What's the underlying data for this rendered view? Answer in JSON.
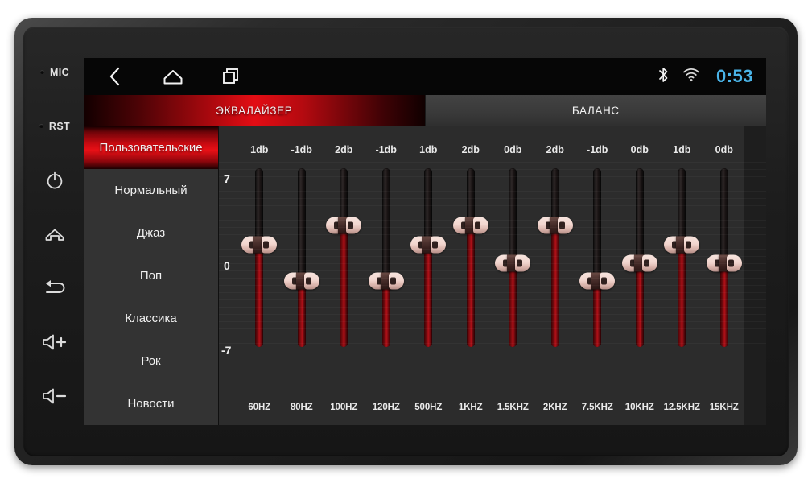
{
  "device": {
    "side_buttons": [
      {
        "name": "mic",
        "label": "MIC",
        "type": "label-hole"
      },
      {
        "name": "rst",
        "label": "RST",
        "type": "label-hole"
      },
      {
        "name": "power",
        "label": "power-icon",
        "type": "icon"
      },
      {
        "name": "home",
        "label": "home-icon",
        "type": "icon"
      },
      {
        "name": "back",
        "label": "back-icon",
        "type": "icon"
      },
      {
        "name": "volume-up",
        "label": "volume-up-icon",
        "type": "icon"
      },
      {
        "name": "volume-down",
        "label": "volume-down-icon",
        "type": "icon"
      }
    ]
  },
  "statusbar": {
    "nav": [
      {
        "name": "back-icon",
        "label": "back"
      },
      {
        "name": "home-icon",
        "label": "home"
      },
      {
        "name": "recents-icon",
        "label": "recents"
      }
    ],
    "bluetooth_icon": "bluetooth-icon",
    "wifi_icon": "wifi-icon",
    "clock": "0:53",
    "clock_color": "#4ab4e8"
  },
  "tabs": [
    {
      "label": "ЭКВАЛАЙЗЕР",
      "active": true
    },
    {
      "label": "БАЛАНС",
      "active": false
    }
  ],
  "presets": [
    {
      "label": "Пользовательские",
      "selected": true
    },
    {
      "label": "Нормальный",
      "selected": false
    },
    {
      "label": "Джаз",
      "selected": false
    },
    {
      "label": "Поп",
      "selected": false
    },
    {
      "label": "Классика",
      "selected": false
    },
    {
      "label": "Рок",
      "selected": false
    },
    {
      "label": "Новости",
      "selected": false
    }
  ],
  "equalizer": {
    "scale_top": "7",
    "scale_mid": "0",
    "scale_bottom": "-7",
    "range_min": -7,
    "range_max": 7,
    "bands": [
      {
        "freq": "60HZ",
        "db_label": "1db",
        "value": 1,
        "thumb_pct": 43
      },
      {
        "freq": "80HZ",
        "db_label": "-1db",
        "value": -1,
        "thumb_pct": 63
      },
      {
        "freq": "100HZ",
        "db_label": "2db",
        "value": 2,
        "thumb_pct": 32
      },
      {
        "freq": "120HZ",
        "db_label": "-1db",
        "value": -1,
        "thumb_pct": 63
      },
      {
        "freq": "500HZ",
        "db_label": "1db",
        "value": 1,
        "thumb_pct": 43
      },
      {
        "freq": "1KHZ",
        "db_label": "2db",
        "value": 2,
        "thumb_pct": 32
      },
      {
        "freq": "1.5KHZ",
        "db_label": "0db",
        "value": 0,
        "thumb_pct": 53
      },
      {
        "freq": "2KHZ",
        "db_label": "2db",
        "value": 2,
        "thumb_pct": 32
      },
      {
        "freq": "7.5KHZ",
        "db_label": "-1db",
        "value": -1,
        "thumb_pct": 63
      },
      {
        "freq": "10KHZ",
        "db_label": "0db",
        "value": 0,
        "thumb_pct": 53
      },
      {
        "freq": "12.5KHZ",
        "db_label": "1db",
        "value": 1,
        "thumb_pct": 43
      },
      {
        "freq": "15KHZ",
        "db_label": "0db",
        "value": 0,
        "thumb_pct": 53
      }
    ]
  },
  "colors": {
    "accent_red": "#e30d14",
    "panel": "#2c2c2c",
    "list_bg": "#333333",
    "screen_bg": "#1a1a1a"
  }
}
